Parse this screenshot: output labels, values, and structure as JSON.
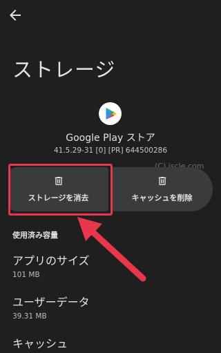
{
  "header": {
    "back_icon": "arrow-back-icon",
    "title": "ストレージ"
  },
  "app": {
    "icon": "google-play-icon",
    "name": "Google Play ストア",
    "version": "41.5.29-31 [0] [PR] 644500286"
  },
  "watermark": "(C) iscle.com",
  "actions": {
    "clear_storage_label": "ストレージを消去",
    "clear_cache_label": "キャッシュを削除",
    "icon": "trash-icon"
  },
  "usage": {
    "header": "使用済み容量",
    "items": [
      {
        "label": "アプリのサイズ",
        "value": "101 MB"
      },
      {
        "label": "ユーザーデータ",
        "value": "39.31 MB"
      },
      {
        "label": "キャッシュ",
        "value": ""
      }
    ]
  },
  "colors": {
    "background": "#1f1f1f",
    "button": "#3a3b3c",
    "highlight": "#e8364b"
  }
}
